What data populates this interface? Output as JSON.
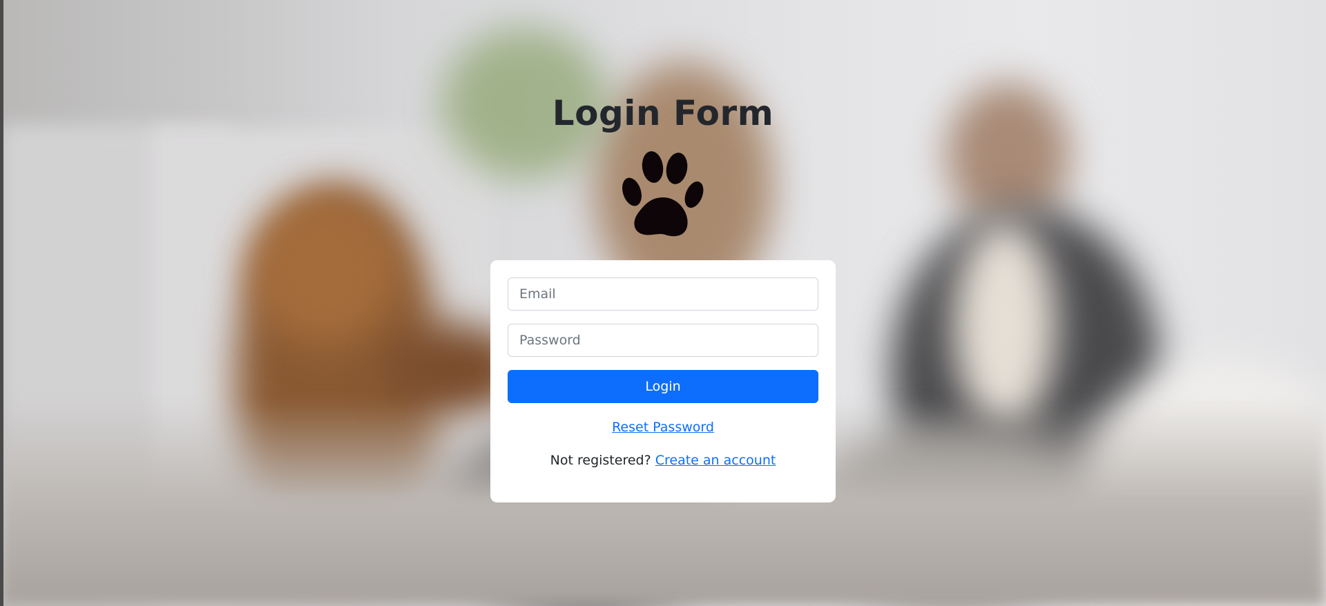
{
  "page": {
    "title": "Login Form",
    "logo_icon": "paw-print-icon"
  },
  "form": {
    "email_placeholder": "Email",
    "email_value": "",
    "password_placeholder": "Password",
    "password_value": "",
    "login_label": "Login",
    "reset_label": "Reset Password",
    "register_prompt": "Not registered?",
    "register_link": "Create an account"
  },
  "colors": {
    "primary": "#0d6efd",
    "title": "#23272d",
    "card_bg": "#ffffff"
  }
}
